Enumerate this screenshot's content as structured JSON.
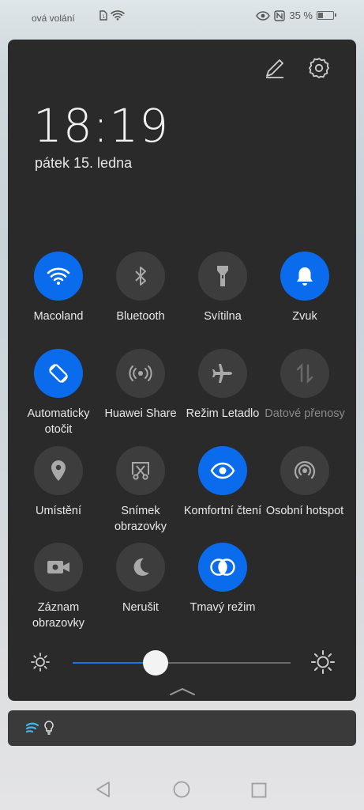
{
  "status_bar": {
    "carrier_text": "ová volání",
    "battery_text": "35 %",
    "battery_level": 0.35
  },
  "panel": {
    "time": "18:19",
    "date": "pátek 15. ledna"
  },
  "tiles": [
    {
      "label": "Macoland",
      "state": "on",
      "icon": "wifi-icon"
    },
    {
      "label": "Bluetooth",
      "state": "off",
      "icon": "bluetooth-icon"
    },
    {
      "label": "Svítilna",
      "state": "off",
      "icon": "flashlight-icon"
    },
    {
      "label": "Zvuk",
      "state": "on",
      "icon": "bell-icon"
    },
    {
      "label": "Automaticky otočit",
      "state": "on",
      "icon": "auto-rotate-icon"
    },
    {
      "label": "Huawei Share",
      "state": "off",
      "icon": "huawei-share-icon"
    },
    {
      "label": "Režim Letadlo",
      "state": "off",
      "icon": "airplane-icon"
    },
    {
      "label": "Datové přenosy",
      "state": "disabled",
      "icon": "mobile-data-icon"
    },
    {
      "label": "Umístění",
      "state": "off",
      "icon": "location-pin-icon"
    },
    {
      "label": "Snímek obrazovky",
      "state": "off",
      "icon": "screenshot-icon"
    },
    {
      "label": "Komfortní čtení",
      "state": "on",
      "icon": "eye-icon"
    },
    {
      "label": "Osobní hotspot",
      "state": "off",
      "icon": "hotspot-icon"
    },
    {
      "label": "Záznam obrazovky",
      "state": "off",
      "icon": "screen-record-icon"
    },
    {
      "label": "Nerušit",
      "state": "off",
      "icon": "moon-icon"
    },
    {
      "label": "Tmavý režim",
      "state": "on",
      "icon": "dark-mode-icon"
    }
  ],
  "brightness": {
    "level": 0.38
  },
  "colors": {
    "accent": "#0a6cec",
    "panel_bg": "#2a2a2b",
    "tile_off": "#3d3d3e"
  }
}
